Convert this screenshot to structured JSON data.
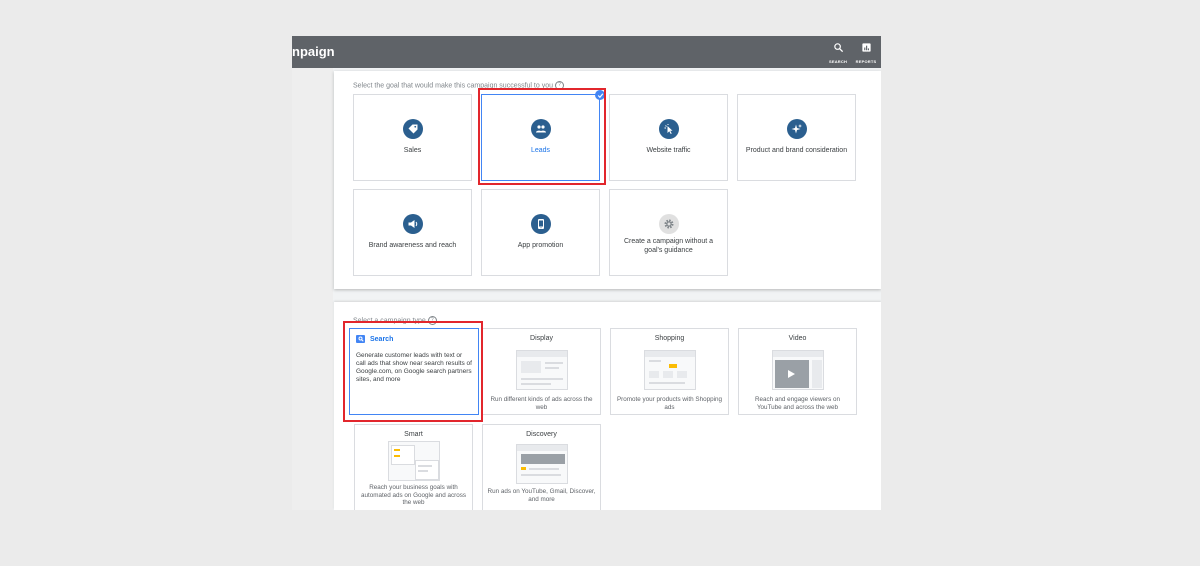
{
  "header": {
    "title": "npaign",
    "search_label": "SEARCH",
    "reports_label": "REPORTS"
  },
  "goals": {
    "prompt": "Select the goal that would make this campaign successful to you",
    "items": [
      {
        "label": "Sales",
        "icon": "tag-icon"
      },
      {
        "label": "Leads",
        "icon": "people-icon",
        "selected": true
      },
      {
        "label": "Website traffic",
        "icon": "cursor-click-icon"
      },
      {
        "label": "Product and brand consideration",
        "icon": "sparkle-icon"
      },
      {
        "label": "Brand awareness and reach",
        "icon": "megaphone-icon"
      },
      {
        "label": "App promotion",
        "icon": "smartphone-icon"
      },
      {
        "label": "Create a campaign without a goal's guidance",
        "icon": "gear-icon"
      }
    ]
  },
  "campaign_types": {
    "prompt": "Select a campaign type",
    "items": [
      {
        "title": "Search",
        "desc": "Generate customer leads with text or call ads that show near search results of Google.com, on Google search partners sites, and more",
        "selected": true
      },
      {
        "title": "Display",
        "desc": "Run different kinds of ads across the web"
      },
      {
        "title": "Shopping",
        "desc": "Promote your products with Shopping ads"
      },
      {
        "title": "Video",
        "desc": "Reach and engage viewers on YouTube and across the web"
      },
      {
        "title": "Smart",
        "desc": "Reach your business goals with automated ads on Google and across the web"
      },
      {
        "title": "Discovery",
        "desc": "Run ads on YouTube, Gmail, Discover, and more"
      }
    ]
  },
  "colors": {
    "topbar": "#5f6368",
    "goal_icon": "#2b5f8f",
    "accent": "#1a73e8",
    "highlight": "#e2262c"
  }
}
